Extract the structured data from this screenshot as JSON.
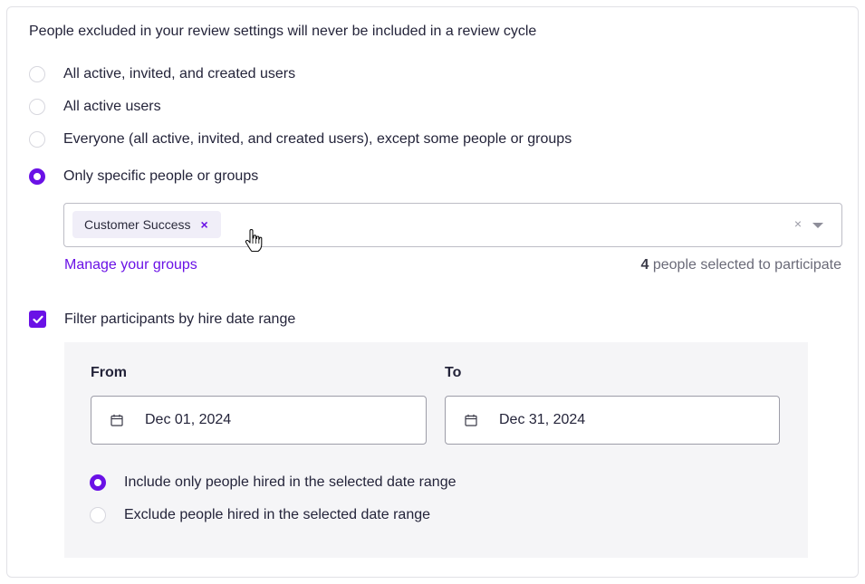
{
  "intro": "People excluded in your review settings will never be included in a review cycle",
  "participant_options": [
    {
      "label": "All active, invited, and created users",
      "selected": false
    },
    {
      "label": "All active users",
      "selected": false
    },
    {
      "label": "Everyone (all active, invited, and created users), except some people or groups",
      "selected": false
    },
    {
      "label": "Only specific people or groups",
      "selected": true
    }
  ],
  "group_select": {
    "chips": [
      {
        "label": "Customer Success",
        "remove": "×"
      }
    ],
    "clear": "×"
  },
  "manage_groups_link": "Manage your groups",
  "selected_count": {
    "number": "4",
    "text": "people selected to participate"
  },
  "hire_date_filter": {
    "label": "Filter participants by hire date range",
    "checked": true,
    "from_label": "From",
    "from_value": "Dec 01, 2024",
    "to_label": "To",
    "to_value": "Dec 31, 2024",
    "mode_options": [
      {
        "label": "Include only people hired in the selected date range",
        "selected": true
      },
      {
        "label": "Exclude people hired in the selected date range",
        "selected": false
      }
    ]
  },
  "colors": {
    "accent": "#6a11e6",
    "panel_bg": "#f5f5f7",
    "border": "#bdbdc6"
  }
}
